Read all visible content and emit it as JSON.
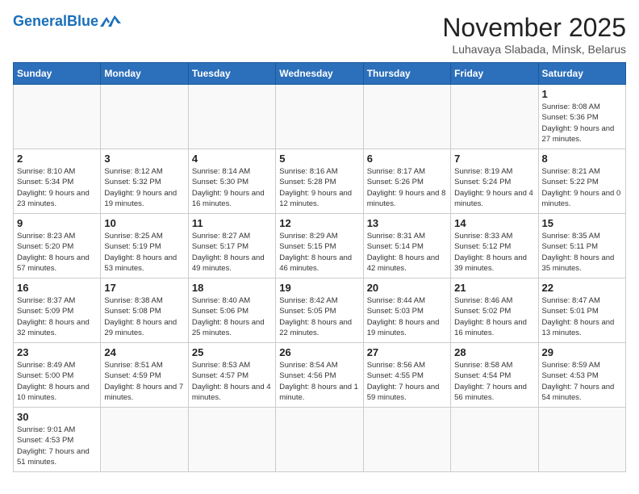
{
  "header": {
    "logo_general": "General",
    "logo_blue": "Blue",
    "month_title": "November 2025",
    "location": "Luhavaya Slabada, Minsk, Belarus"
  },
  "days_of_week": [
    "Sunday",
    "Monday",
    "Tuesday",
    "Wednesday",
    "Thursday",
    "Friday",
    "Saturday"
  ],
  "weeks": [
    [
      {
        "day": "",
        "info": ""
      },
      {
        "day": "",
        "info": ""
      },
      {
        "day": "",
        "info": ""
      },
      {
        "day": "",
        "info": ""
      },
      {
        "day": "",
        "info": ""
      },
      {
        "day": "",
        "info": ""
      },
      {
        "day": "1",
        "info": "Sunrise: 8:08 AM\nSunset: 5:36 PM\nDaylight: 9 hours\nand 27 minutes."
      }
    ],
    [
      {
        "day": "2",
        "info": "Sunrise: 8:10 AM\nSunset: 5:34 PM\nDaylight: 9 hours\nand 23 minutes."
      },
      {
        "day": "3",
        "info": "Sunrise: 8:12 AM\nSunset: 5:32 PM\nDaylight: 9 hours\nand 19 minutes."
      },
      {
        "day": "4",
        "info": "Sunrise: 8:14 AM\nSunset: 5:30 PM\nDaylight: 9 hours\nand 16 minutes."
      },
      {
        "day": "5",
        "info": "Sunrise: 8:16 AM\nSunset: 5:28 PM\nDaylight: 9 hours\nand 12 minutes."
      },
      {
        "day": "6",
        "info": "Sunrise: 8:17 AM\nSunset: 5:26 PM\nDaylight: 9 hours\nand 8 minutes."
      },
      {
        "day": "7",
        "info": "Sunrise: 8:19 AM\nSunset: 5:24 PM\nDaylight: 9 hours\nand 4 minutes."
      },
      {
        "day": "8",
        "info": "Sunrise: 8:21 AM\nSunset: 5:22 PM\nDaylight: 9 hours\nand 0 minutes."
      }
    ],
    [
      {
        "day": "9",
        "info": "Sunrise: 8:23 AM\nSunset: 5:20 PM\nDaylight: 8 hours\nand 57 minutes."
      },
      {
        "day": "10",
        "info": "Sunrise: 8:25 AM\nSunset: 5:19 PM\nDaylight: 8 hours\nand 53 minutes."
      },
      {
        "day": "11",
        "info": "Sunrise: 8:27 AM\nSunset: 5:17 PM\nDaylight: 8 hours\nand 49 minutes."
      },
      {
        "day": "12",
        "info": "Sunrise: 8:29 AM\nSunset: 5:15 PM\nDaylight: 8 hours\nand 46 minutes."
      },
      {
        "day": "13",
        "info": "Sunrise: 8:31 AM\nSunset: 5:14 PM\nDaylight: 8 hours\nand 42 minutes."
      },
      {
        "day": "14",
        "info": "Sunrise: 8:33 AM\nSunset: 5:12 PM\nDaylight: 8 hours\nand 39 minutes."
      },
      {
        "day": "15",
        "info": "Sunrise: 8:35 AM\nSunset: 5:11 PM\nDaylight: 8 hours\nand 35 minutes."
      }
    ],
    [
      {
        "day": "16",
        "info": "Sunrise: 8:37 AM\nSunset: 5:09 PM\nDaylight: 8 hours\nand 32 minutes."
      },
      {
        "day": "17",
        "info": "Sunrise: 8:38 AM\nSunset: 5:08 PM\nDaylight: 8 hours\nand 29 minutes."
      },
      {
        "day": "18",
        "info": "Sunrise: 8:40 AM\nSunset: 5:06 PM\nDaylight: 8 hours\nand 25 minutes."
      },
      {
        "day": "19",
        "info": "Sunrise: 8:42 AM\nSunset: 5:05 PM\nDaylight: 8 hours\nand 22 minutes."
      },
      {
        "day": "20",
        "info": "Sunrise: 8:44 AM\nSunset: 5:03 PM\nDaylight: 8 hours\nand 19 minutes."
      },
      {
        "day": "21",
        "info": "Sunrise: 8:46 AM\nSunset: 5:02 PM\nDaylight: 8 hours\nand 16 minutes."
      },
      {
        "day": "22",
        "info": "Sunrise: 8:47 AM\nSunset: 5:01 PM\nDaylight: 8 hours\nand 13 minutes."
      }
    ],
    [
      {
        "day": "23",
        "info": "Sunrise: 8:49 AM\nSunset: 5:00 PM\nDaylight: 8 hours\nand 10 minutes."
      },
      {
        "day": "24",
        "info": "Sunrise: 8:51 AM\nSunset: 4:59 PM\nDaylight: 8 hours\nand 7 minutes."
      },
      {
        "day": "25",
        "info": "Sunrise: 8:53 AM\nSunset: 4:57 PM\nDaylight: 8 hours\nand 4 minutes."
      },
      {
        "day": "26",
        "info": "Sunrise: 8:54 AM\nSunset: 4:56 PM\nDaylight: 8 hours\nand 1 minute."
      },
      {
        "day": "27",
        "info": "Sunrise: 8:56 AM\nSunset: 4:55 PM\nDaylight: 7 hours\nand 59 minutes."
      },
      {
        "day": "28",
        "info": "Sunrise: 8:58 AM\nSunset: 4:54 PM\nDaylight: 7 hours\nand 56 minutes."
      },
      {
        "day": "29",
        "info": "Sunrise: 8:59 AM\nSunset: 4:53 PM\nDaylight: 7 hours\nand 54 minutes."
      }
    ],
    [
      {
        "day": "30",
        "info": "Sunrise: 9:01 AM\nSunset: 4:53 PM\nDaylight: 7 hours\nand 51 minutes."
      },
      {
        "day": "",
        "info": ""
      },
      {
        "day": "",
        "info": ""
      },
      {
        "day": "",
        "info": ""
      },
      {
        "day": "",
        "info": ""
      },
      {
        "day": "",
        "info": ""
      },
      {
        "day": "",
        "info": ""
      }
    ]
  ]
}
